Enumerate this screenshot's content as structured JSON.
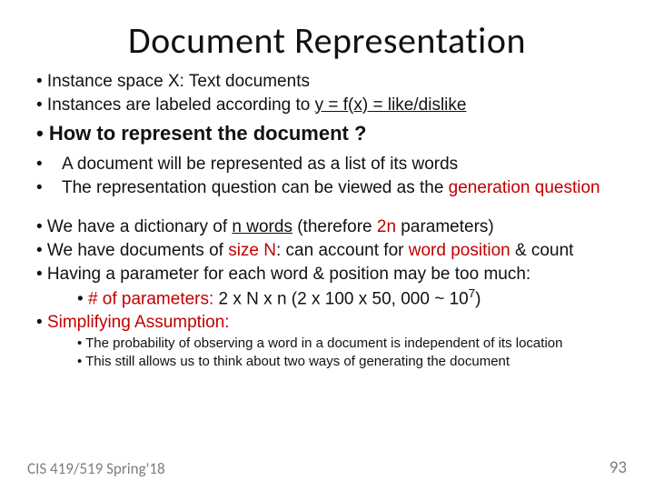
{
  "title": "Document Representation",
  "b1": "• Instance space X: Text documents",
  "b2_pre": "• Instances are labeled according to ",
  "b2_u": "y = f(x) = like/dislike",
  "b3": "• How to represent the document ?",
  "b4": "A document will be represented as a list of its words",
  "b5_pre": "The representation question can be viewed as the ",
  "b5_red": "generation question",
  "b6_a": "• We have a dictionary of ",
  "b6_n": "n words",
  "b6_b": "  (therefore ",
  "b6_2n": "2n",
  "b6_c": " parameters)",
  "b7_a": "• We have documents of ",
  "b7_size": "size N",
  "b7_b": ": can account for ",
  "b7_wp": "word position",
  "b7_c": " & count",
  "b8": "• Having a parameter for each word & position may be too much:",
  "b9_a": "• ",
  "b9_label": "# of parameters:",
  "b9_b": " 2 x N x n (2 x 100 x 50, 000 ~ 10",
  "b9_sup": "7",
  "b9_c": ")",
  "b10_a": "• ",
  "b10_red": "Simplifying Assumption:",
  "b11": "• The probability of observing a word in a document is independent of its location",
  "b12": "• This still allows us to think about two ways of generating the document",
  "footer_left": "CIS 419/519 Spring'18",
  "footer_right": "93"
}
